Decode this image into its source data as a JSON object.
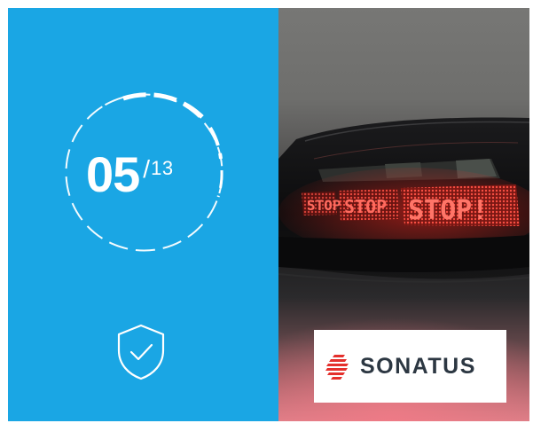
{
  "counter": {
    "current": "05",
    "separator": "/",
    "total": "13"
  },
  "icons": {
    "progress": "progress-ring-icon",
    "shield": "shield-check-icon",
    "logo": "sonatus-logo-icon"
  },
  "photo": {
    "sign_text": [
      "STOP",
      "STOP",
      "STOP!"
    ]
  },
  "logo": {
    "name": "SONATUS"
  },
  "colors": {
    "accent": "#1aa6e4",
    "sign_red": "#e8261f",
    "logo_red": "#e4302c",
    "logo_text": "#2c3742"
  }
}
